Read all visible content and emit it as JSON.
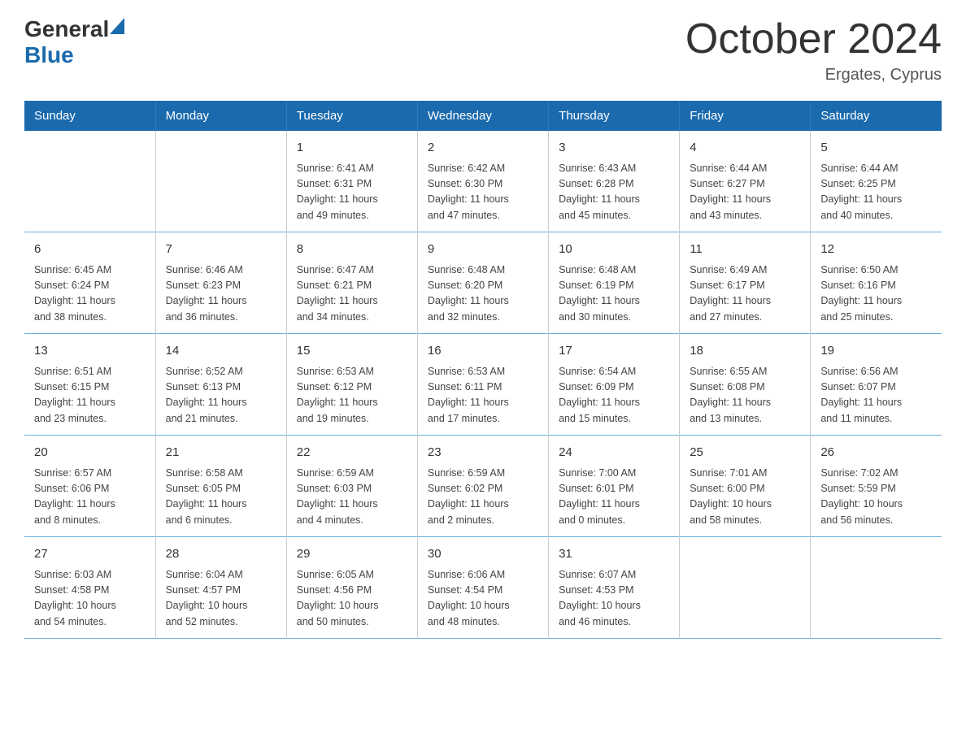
{
  "header": {
    "logo": {
      "general": "General",
      "blue": "Blue"
    },
    "title": "October 2024",
    "location": "Ergates, Cyprus"
  },
  "calendar": {
    "weekdays": [
      "Sunday",
      "Monday",
      "Tuesday",
      "Wednesday",
      "Thursday",
      "Friday",
      "Saturday"
    ],
    "weeks": [
      [
        {
          "day": "",
          "info": ""
        },
        {
          "day": "",
          "info": ""
        },
        {
          "day": "1",
          "info": "Sunrise: 6:41 AM\nSunset: 6:31 PM\nDaylight: 11 hours\nand 49 minutes."
        },
        {
          "day": "2",
          "info": "Sunrise: 6:42 AM\nSunset: 6:30 PM\nDaylight: 11 hours\nand 47 minutes."
        },
        {
          "day": "3",
          "info": "Sunrise: 6:43 AM\nSunset: 6:28 PM\nDaylight: 11 hours\nand 45 minutes."
        },
        {
          "day": "4",
          "info": "Sunrise: 6:44 AM\nSunset: 6:27 PM\nDaylight: 11 hours\nand 43 minutes."
        },
        {
          "day": "5",
          "info": "Sunrise: 6:44 AM\nSunset: 6:25 PM\nDaylight: 11 hours\nand 40 minutes."
        }
      ],
      [
        {
          "day": "6",
          "info": "Sunrise: 6:45 AM\nSunset: 6:24 PM\nDaylight: 11 hours\nand 38 minutes."
        },
        {
          "day": "7",
          "info": "Sunrise: 6:46 AM\nSunset: 6:23 PM\nDaylight: 11 hours\nand 36 minutes."
        },
        {
          "day": "8",
          "info": "Sunrise: 6:47 AM\nSunset: 6:21 PM\nDaylight: 11 hours\nand 34 minutes."
        },
        {
          "day": "9",
          "info": "Sunrise: 6:48 AM\nSunset: 6:20 PM\nDaylight: 11 hours\nand 32 minutes."
        },
        {
          "day": "10",
          "info": "Sunrise: 6:48 AM\nSunset: 6:19 PM\nDaylight: 11 hours\nand 30 minutes."
        },
        {
          "day": "11",
          "info": "Sunrise: 6:49 AM\nSunset: 6:17 PM\nDaylight: 11 hours\nand 27 minutes."
        },
        {
          "day": "12",
          "info": "Sunrise: 6:50 AM\nSunset: 6:16 PM\nDaylight: 11 hours\nand 25 minutes."
        }
      ],
      [
        {
          "day": "13",
          "info": "Sunrise: 6:51 AM\nSunset: 6:15 PM\nDaylight: 11 hours\nand 23 minutes."
        },
        {
          "day": "14",
          "info": "Sunrise: 6:52 AM\nSunset: 6:13 PM\nDaylight: 11 hours\nand 21 minutes."
        },
        {
          "day": "15",
          "info": "Sunrise: 6:53 AM\nSunset: 6:12 PM\nDaylight: 11 hours\nand 19 minutes."
        },
        {
          "day": "16",
          "info": "Sunrise: 6:53 AM\nSunset: 6:11 PM\nDaylight: 11 hours\nand 17 minutes."
        },
        {
          "day": "17",
          "info": "Sunrise: 6:54 AM\nSunset: 6:09 PM\nDaylight: 11 hours\nand 15 minutes."
        },
        {
          "day": "18",
          "info": "Sunrise: 6:55 AM\nSunset: 6:08 PM\nDaylight: 11 hours\nand 13 minutes."
        },
        {
          "day": "19",
          "info": "Sunrise: 6:56 AM\nSunset: 6:07 PM\nDaylight: 11 hours\nand 11 minutes."
        }
      ],
      [
        {
          "day": "20",
          "info": "Sunrise: 6:57 AM\nSunset: 6:06 PM\nDaylight: 11 hours\nand 8 minutes."
        },
        {
          "day": "21",
          "info": "Sunrise: 6:58 AM\nSunset: 6:05 PM\nDaylight: 11 hours\nand 6 minutes."
        },
        {
          "day": "22",
          "info": "Sunrise: 6:59 AM\nSunset: 6:03 PM\nDaylight: 11 hours\nand 4 minutes."
        },
        {
          "day": "23",
          "info": "Sunrise: 6:59 AM\nSunset: 6:02 PM\nDaylight: 11 hours\nand 2 minutes."
        },
        {
          "day": "24",
          "info": "Sunrise: 7:00 AM\nSunset: 6:01 PM\nDaylight: 11 hours\nand 0 minutes."
        },
        {
          "day": "25",
          "info": "Sunrise: 7:01 AM\nSunset: 6:00 PM\nDaylight: 10 hours\nand 58 minutes."
        },
        {
          "day": "26",
          "info": "Sunrise: 7:02 AM\nSunset: 5:59 PM\nDaylight: 10 hours\nand 56 minutes."
        }
      ],
      [
        {
          "day": "27",
          "info": "Sunrise: 6:03 AM\nSunset: 4:58 PM\nDaylight: 10 hours\nand 54 minutes."
        },
        {
          "day": "28",
          "info": "Sunrise: 6:04 AM\nSunset: 4:57 PM\nDaylight: 10 hours\nand 52 minutes."
        },
        {
          "day": "29",
          "info": "Sunrise: 6:05 AM\nSunset: 4:56 PM\nDaylight: 10 hours\nand 50 minutes."
        },
        {
          "day": "30",
          "info": "Sunrise: 6:06 AM\nSunset: 4:54 PM\nDaylight: 10 hours\nand 48 minutes."
        },
        {
          "day": "31",
          "info": "Sunrise: 6:07 AM\nSunset: 4:53 PM\nDaylight: 10 hours\nand 46 minutes."
        },
        {
          "day": "",
          "info": ""
        },
        {
          "day": "",
          "info": ""
        }
      ]
    ]
  }
}
